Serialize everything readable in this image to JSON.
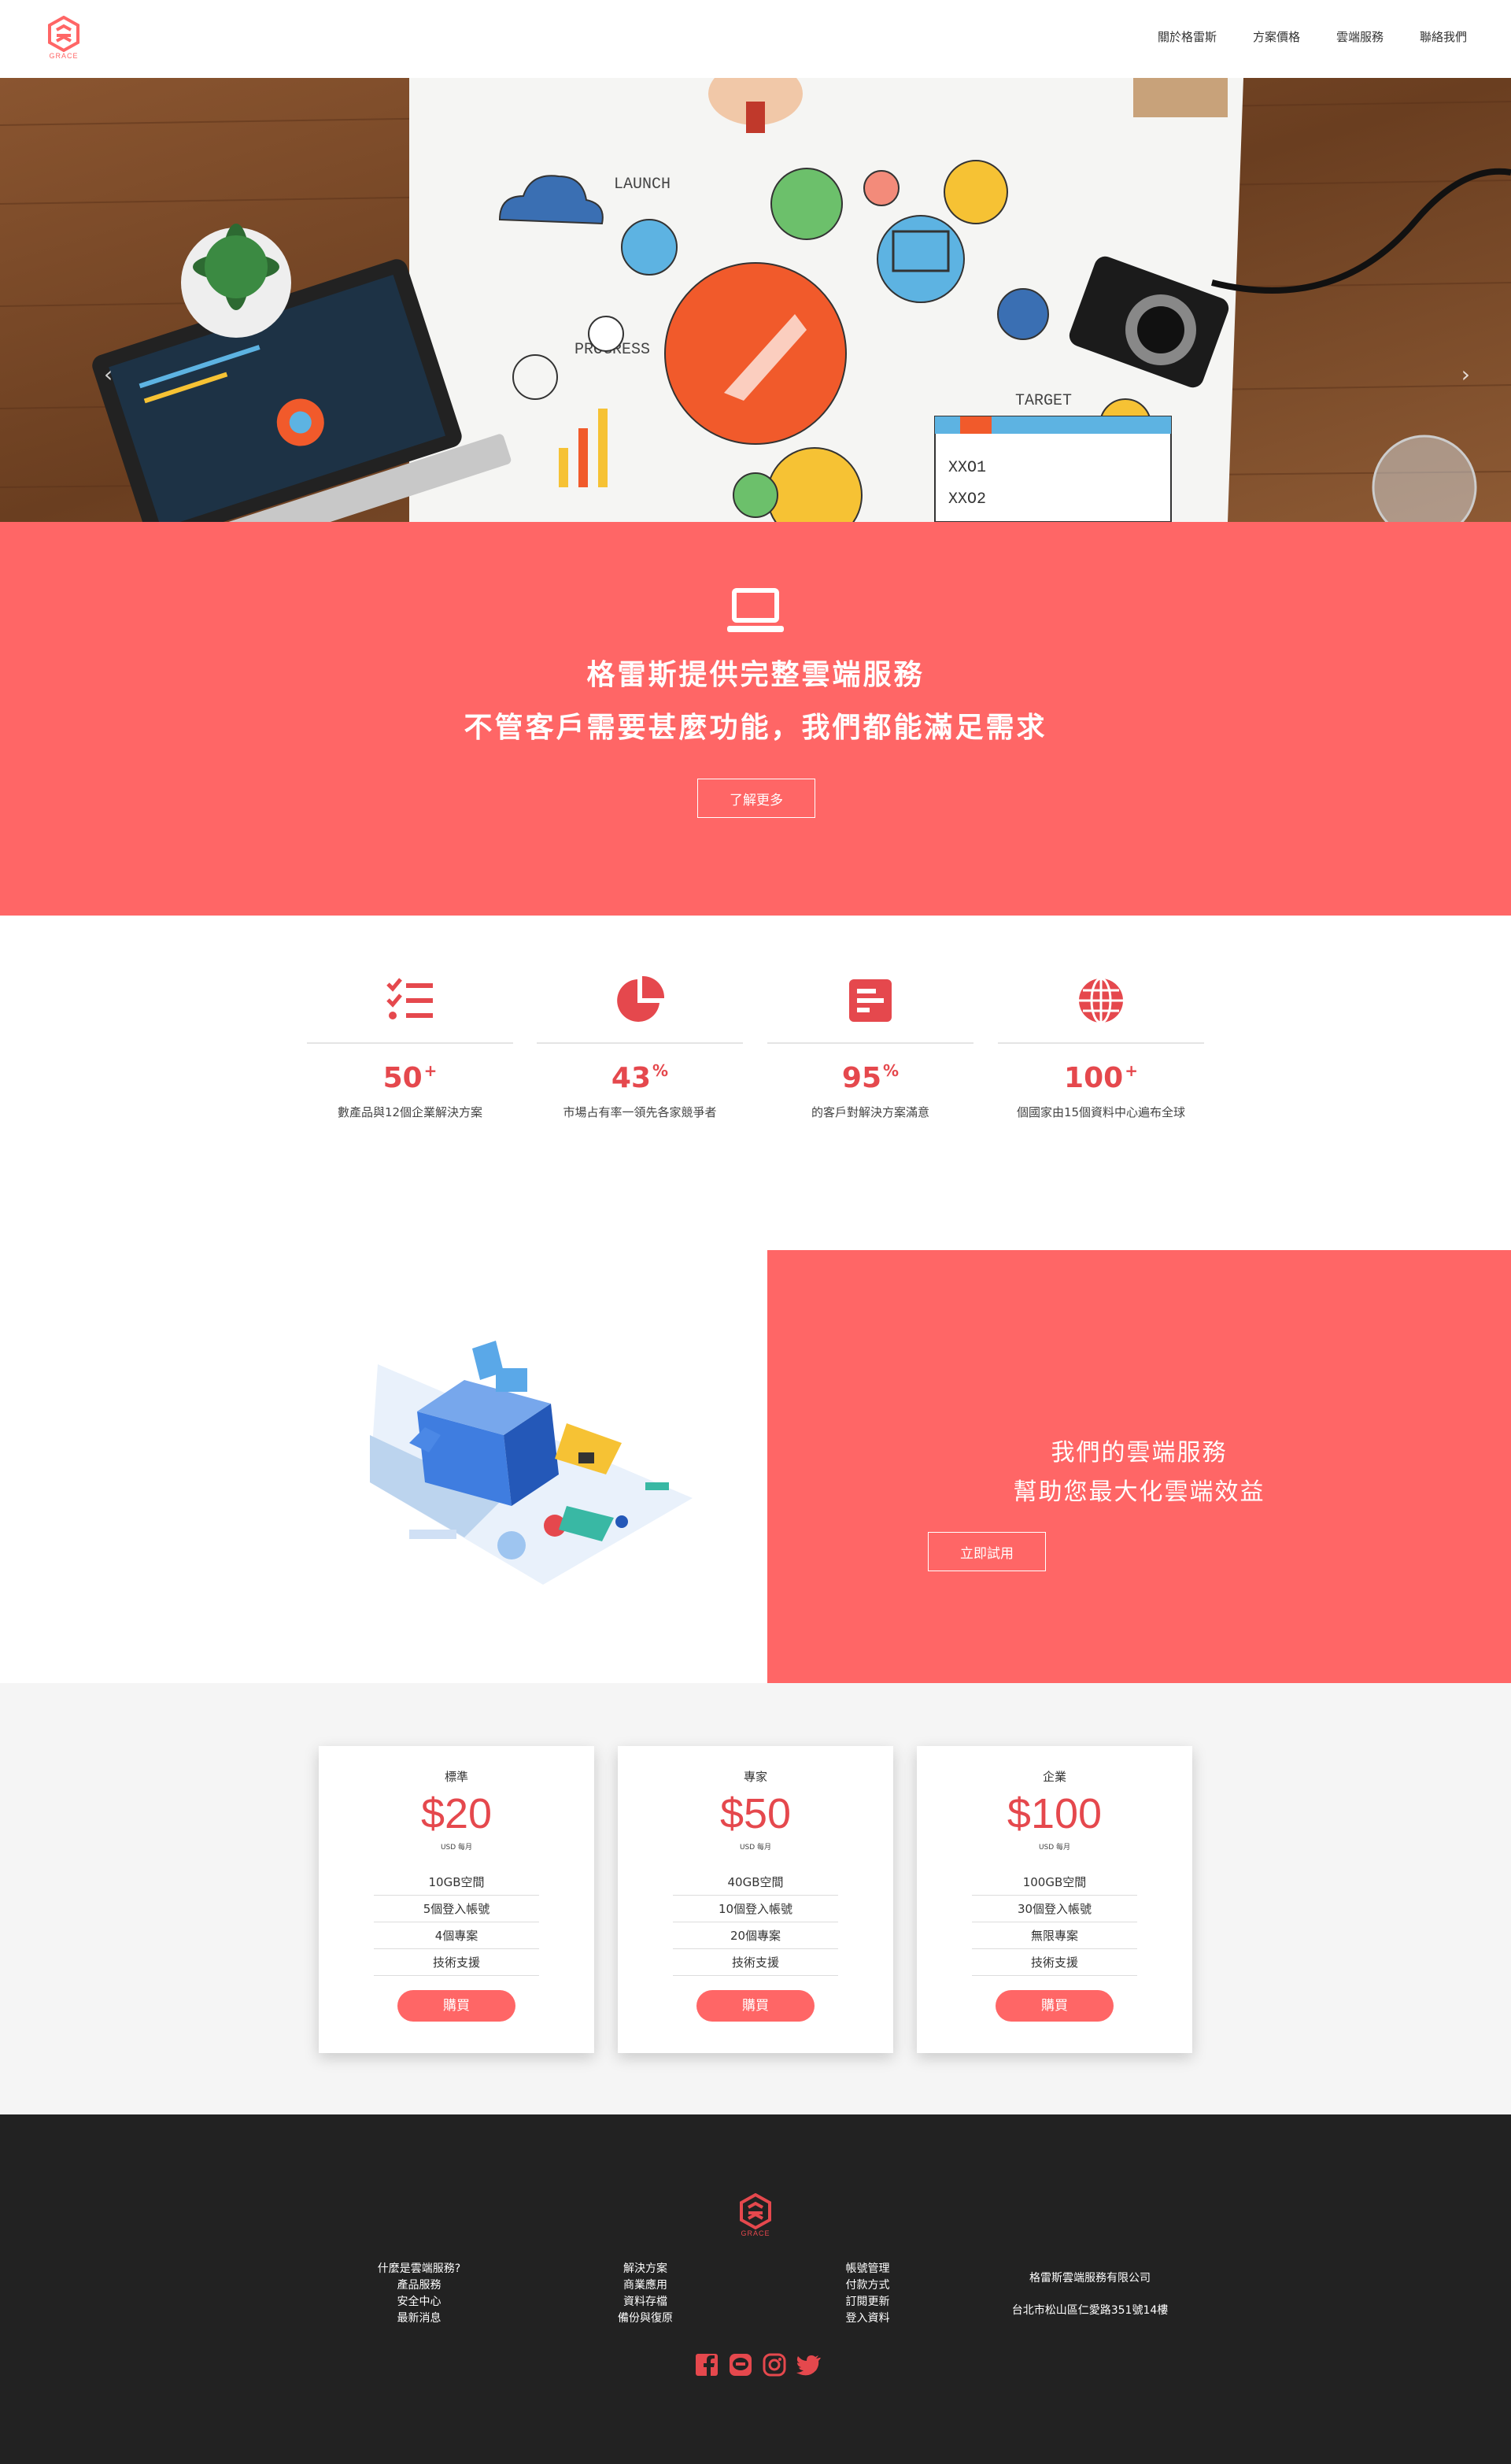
{
  "brand": {
    "logo_text": "GRACE",
    "accent": "#ff6666",
    "accent_dark": "#e5484d"
  },
  "nav": {
    "items": [
      "關於格雷斯",
      "方案價格",
      "雲端服務",
      "聯絡我們"
    ]
  },
  "hero": {
    "icons": [
      "chevron-left-icon",
      "chevron-right-icon"
    ],
    "slides": 3,
    "active_slide": 0
  },
  "banner": {
    "title1": "格雷斯提供完整雲端服務",
    "title2": "不管客戶需要甚麼功能，我們都能滿足需求",
    "button": "了解更多",
    "icon": "laptop-icon"
  },
  "stats": [
    {
      "icon": "checklist-icon",
      "number": "50",
      "suffix": "+",
      "desc": "數產品與12個企業解決方案"
    },
    {
      "icon": "pie-chart-icon",
      "number": "43",
      "suffix": "%",
      "desc": "市場占有率一領先各家競爭者"
    },
    {
      "icon": "bar-chart-icon",
      "number": "95",
      "suffix": "%",
      "desc": "的客戶對解決方案滿意"
    },
    {
      "icon": "globe-icon",
      "number": "100",
      "suffix": "+",
      "desc": "個國家由15個資料中心遍布全球"
    }
  ],
  "feature": {
    "title1": "我們的雲端服務",
    "title2": "幫助您最大化雲端效益",
    "button": "立即試用"
  },
  "pricing": [
    {
      "name": "標準",
      "price": "$20",
      "unit": "USD 每月",
      "features": [
        "10GB空間",
        "5個登入帳號",
        "4個專案",
        "技術支援"
      ],
      "button": "購買"
    },
    {
      "name": "專家",
      "price": "$50",
      "unit": "USD 每月",
      "features": [
        "40GB空間",
        "10個登入帳號",
        "20個專案",
        "技術支援"
      ],
      "button": "購買"
    },
    {
      "name": "企業",
      "price": "$100",
      "unit": "USD 每月",
      "features": [
        "100GB空間",
        "30個登入帳號",
        "無限專案",
        "技術支援"
      ],
      "button": "購買"
    }
  ],
  "footer": {
    "col1": [
      "什麼是雲端服務?",
      "產品服務",
      "安全中心",
      "最新消息"
    ],
    "col2": [
      "解決方案",
      "商業應用",
      "資料存檔",
      "備份與復原"
    ],
    "col3": [
      "帳號管理",
      "付款方式",
      "訂閱更新",
      "登入資料"
    ],
    "company": "格雷斯雲端服務有限公司",
    "address": "台北市松山區仁愛路351號14樓",
    "socials": [
      "facebook-icon",
      "line-icon",
      "instagram-icon",
      "twitter-icon"
    ]
  }
}
